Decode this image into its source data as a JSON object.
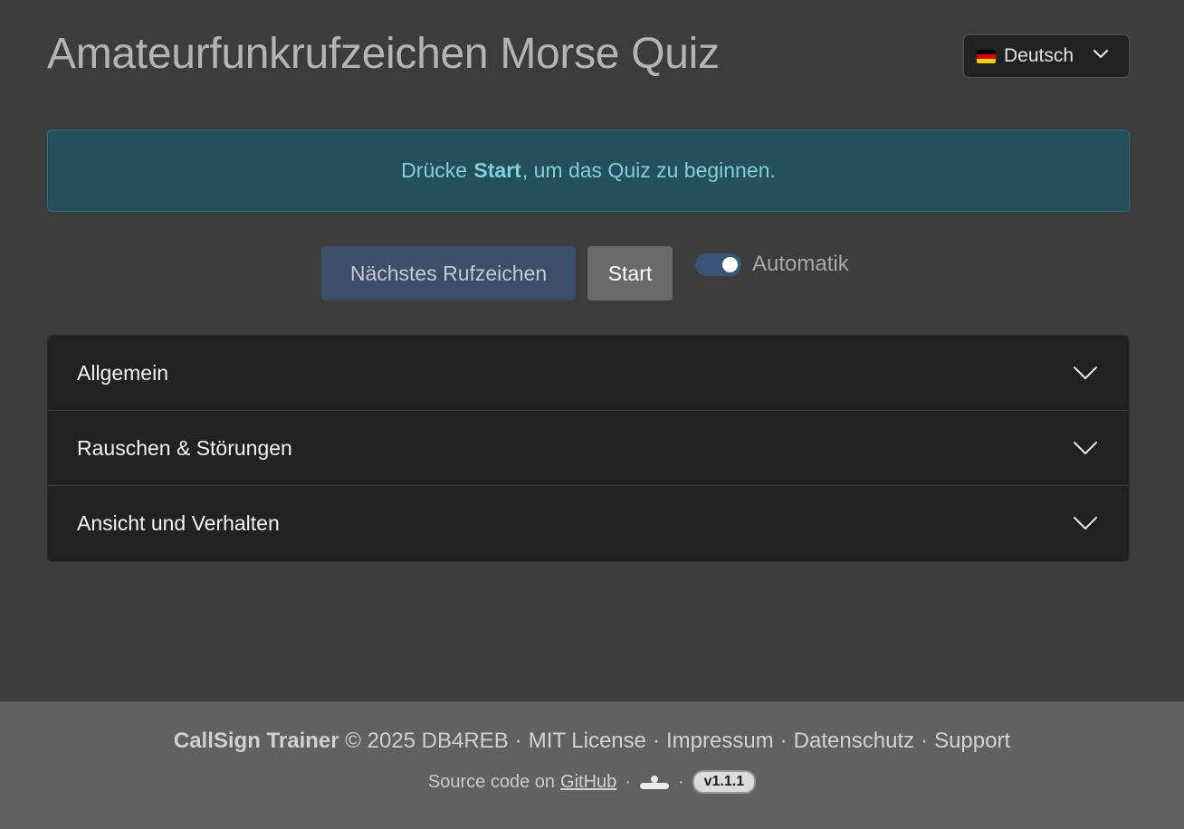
{
  "header": {
    "title": "Amateurfunkrufzeichen Morse Quiz",
    "language": {
      "label": "Deutsch",
      "flag_icon": "flag-de-icon",
      "colors": [
        "#000000",
        "#dd0000",
        "#ffce00"
      ]
    }
  },
  "alert": {
    "before": "Drücke",
    "strong": "Start",
    "after": ", um das Quiz zu beginnen."
  },
  "controls": {
    "next_label": "Nächstes Rufzeichen",
    "start_label": "Start",
    "auto_label": "Automatik",
    "auto_enabled": true
  },
  "accordion": {
    "items": [
      {
        "label": "Allgemein"
      },
      {
        "label": "Rauschen & Störungen"
      },
      {
        "label": "Ansicht und Verhalten"
      }
    ]
  },
  "footer": {
    "brand": "CallSign Trainer",
    "copyright": "© 2025 DB4REB",
    "separator": "·",
    "links": {
      "license": "MIT License",
      "impressum": "Impressum",
      "datenschutz": "Datenschutz",
      "support": "Support"
    },
    "source_text": "Source code on",
    "github_link": "GitHub",
    "user_icon": "user-icon",
    "version": "v1.1.1"
  },
  "colors": {
    "background": "#3c3c3c",
    "alert_bg": "#254f5a",
    "alert_text": "#7fd0da",
    "accent_toggle": "#3d5479",
    "footer_bg": "#616161"
  }
}
